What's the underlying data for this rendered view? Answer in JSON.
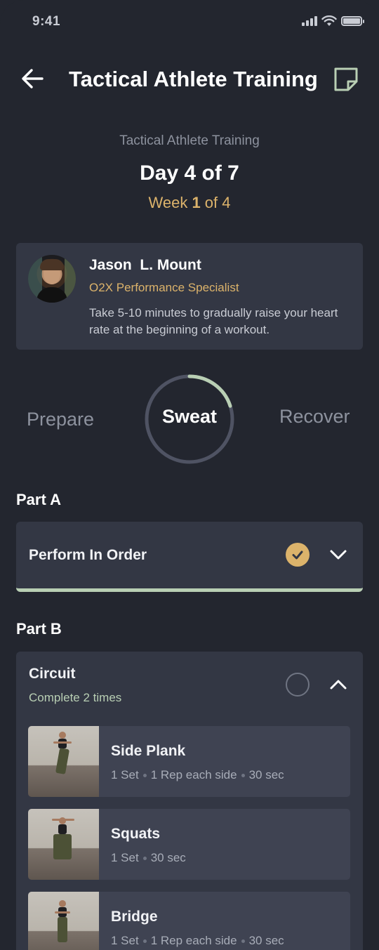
{
  "status_bar": {
    "time": "9:41"
  },
  "header": {
    "title": "Tactical Athlete Training",
    "back_icon": "arrow-left-icon",
    "note_icon": "sticky-note-icon"
  },
  "session": {
    "program_name": "Tactical Athlete Training",
    "day_title": "Day 4 of 7",
    "week_prefix": "Week ",
    "week_current": "1",
    "week_suffix": " of 4"
  },
  "coach": {
    "name": "Jason  L. Mount",
    "role": "O2X Performance Specialist",
    "tip": "Take 5-10 minutes to gradually raise your heart rate at the beginning of a workout."
  },
  "phases": {
    "items": [
      "Prepare",
      "Sweat",
      "Recover"
    ],
    "active": "Sweat",
    "active_progress": 0.2
  },
  "part_a": {
    "label": "Part A",
    "block_title": "Perform In Order",
    "completed": true
  },
  "part_b": {
    "label": "Part B",
    "block_title": "Circuit",
    "block_subtitle": "Complete 2 times",
    "completed": false,
    "exercises": [
      {
        "name": "Side Plank",
        "meta": [
          "1 Set",
          "1 Rep each side",
          "30 sec"
        ]
      },
      {
        "name": "Squats",
        "meta": [
          "1 Set",
          "30 sec"
        ]
      },
      {
        "name": "Bridge",
        "meta": [
          "1 Set",
          "1 Rep each side",
          "30 sec"
        ]
      }
    ]
  },
  "colors": {
    "background": "#23262f",
    "card": "#333744",
    "accent_gold": "#dcb36b",
    "accent_sage": "#b9cfb4",
    "muted_text": "#8d929e"
  }
}
